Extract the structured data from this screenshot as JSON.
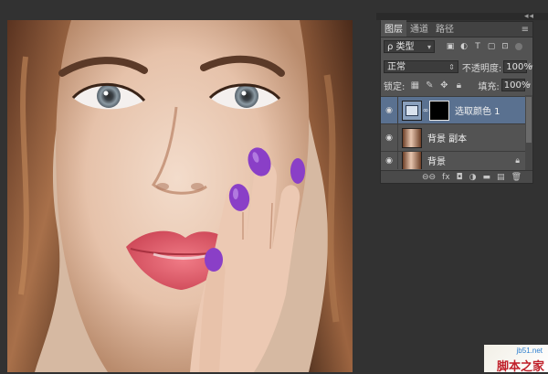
{
  "layers_panel": {
    "tabs": [
      "图层",
      "通道",
      "路径"
    ],
    "tab_menu_icon": "panel-menu-icon",
    "filter_kind": "ρ 类型",
    "blend_mode": "正常",
    "opacity_label": "不透明度:",
    "opacity_value": "100%",
    "lock_label": "锁定:",
    "fill_label": "填充:",
    "fill_value": "100%",
    "layers": [
      {
        "name": "选取颜色 1",
        "selected": true,
        "type": "adjustment"
      },
      {
        "name": "背景 副本",
        "selected": false,
        "type": "image"
      },
      {
        "name": "背景",
        "selected": false,
        "type": "image"
      }
    ]
  },
  "watermark": {
    "url": "jb51.net",
    "text": "脚本之家"
  },
  "colors": {
    "workspace": "#323232",
    "panel": "#535353",
    "selected_layer": "#5a7190",
    "nail_polish": "#8a3fc7",
    "lips": "#e05b6a"
  }
}
